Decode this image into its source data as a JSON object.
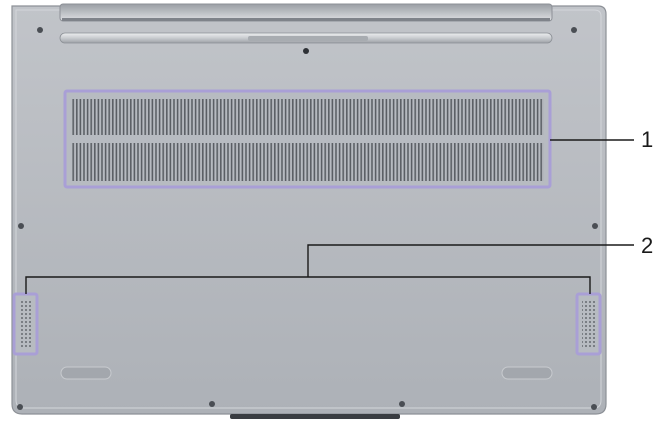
{
  "callouts": [
    {
      "label": "1",
      "target": "bottom-vent"
    },
    {
      "label": "2",
      "target": "speakers"
    }
  ],
  "colors": {
    "chassis": "#b4b8be",
    "chassis_edge": "#8d9197",
    "highlight": "#a99fd6",
    "slot": "#5a5e64",
    "leader_line": "#1a1a1a"
  }
}
